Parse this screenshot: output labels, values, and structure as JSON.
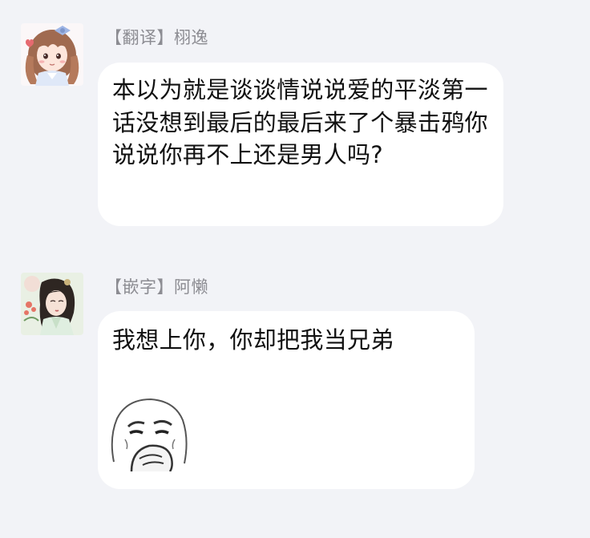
{
  "messages": [
    {
      "sender": "【翻译】栩逸",
      "text": "本以为就是谈谈情说说爱的平淡第一话没想到最后的最后来了个暴击鸦你说说你再不上还是男人吗?",
      "avatar_icon": "anime-girl-avatar-icon"
    },
    {
      "sender": "【嵌字】阿懒",
      "text": "我想上你，你却把我当兄弟",
      "avatar_icon": "painted-lady-avatar-icon",
      "sticker_icon": "meme-face-sticker-icon"
    }
  ],
  "colors": {
    "background": "#f2f3f7",
    "bubble": "#ffffff",
    "sender_text": "#8c8c92",
    "message_text": "#111111"
  }
}
